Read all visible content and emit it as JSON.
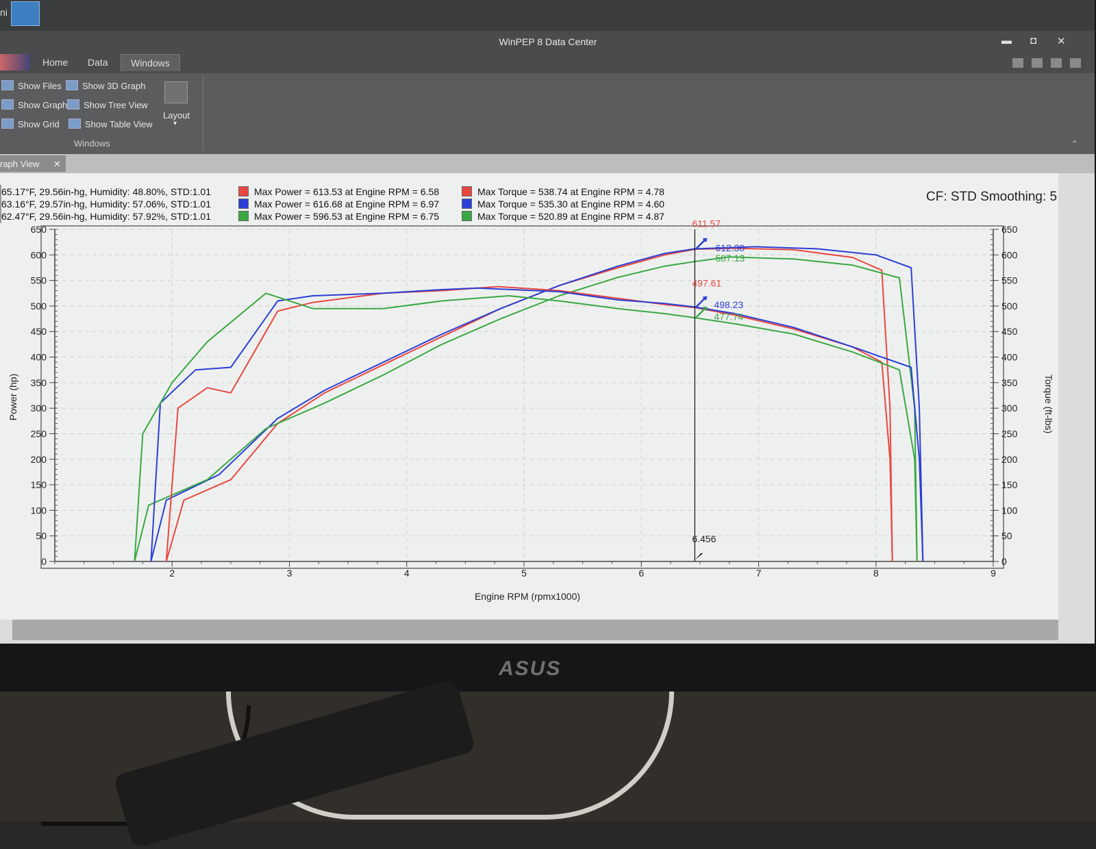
{
  "window": {
    "title": "WinPEP 8 Data Center",
    "desktop_label": "ni",
    "minimize": "▬",
    "maximize": "◘",
    "close": "✕"
  },
  "tabs": {
    "home": "Home",
    "data": "Data",
    "windows": "Windows"
  },
  "ribbon": {
    "show_files": "Show Files",
    "show_graph": "Show Graph",
    "show_grid": "Show Grid",
    "show_3d_graph": "Show 3D Graph",
    "show_tree_view": "Show Tree View",
    "show_table_view": "Show Table View",
    "layout": "Layout",
    "layout_arrow": "▾",
    "group_label": "Windows",
    "collapse": "⌃"
  },
  "doc_tab": {
    "label": "raph View",
    "close": "✕"
  },
  "graph": {
    "cf_text": "CF: STD Smoothing: 5",
    "legend": [
      {
        "conditions": "65.17°F, 29.56in-hg, Humidity: 48.80%, STD:1.01",
        "max_power": "Max Power = 613.53 at Engine RPM = 6.58",
        "max_torque": "Max Torque = 538.74 at Engine RPM = 4.78",
        "color": "#e8473f"
      },
      {
        "conditions": "63.16°F, 29.57in-hg, Humidity: 57.06%, STD:1.01",
        "max_power": "Max Power = 616.68 at Engine RPM = 6.97",
        "max_torque": "Max Torque = 535.30 at Engine RPM = 4.60",
        "color": "#2b3fd6"
      },
      {
        "conditions": "62.47°F, 29.56in-hg, Humidity: 57.92%, STD:1.01",
        "max_power": "Max Power = 596.53 at Engine RPM = 6.75",
        "max_torque": "Max Torque = 520.89 at Engine RPM = 4.87",
        "color": "#3aa843"
      }
    ],
    "cursor": {
      "rpm_label": "6.456",
      "rpm": 6.456
    },
    "cursor_values": {
      "power_red": "611.57",
      "power_blue": "612.30",
      "power_green": "587.13",
      "torque_red": "497.61",
      "torque_blue": "498.23",
      "torque_green": "477.74"
    }
  },
  "chart_data": {
    "type": "line",
    "xlabel": "Engine RPM (rpmx1000)",
    "ylabel": "Power (hp)",
    "y2label": "Torque (ft-lbs)",
    "xlim": [
      1,
      9
    ],
    "ylim": [
      0,
      650
    ],
    "x_ticks": [
      "2",
      "3",
      "4",
      "5",
      "6",
      "7",
      "8",
      "9"
    ],
    "y_ticks": [
      "0",
      "50",
      "100",
      "150",
      "200",
      "250",
      "300",
      "350",
      "400",
      "450",
      "500",
      "550",
      "600",
      "650"
    ],
    "y2_ticks": [
      "0",
      "50",
      "100",
      "150",
      "200",
      "250",
      "300",
      "350",
      "400",
      "450",
      "500",
      "550",
      "600",
      "650"
    ],
    "grid": true,
    "series": [
      {
        "kind": "power",
        "color": "#e8473f",
        "x": [
          1.95,
          2.1,
          2.5,
          2.9,
          3.3,
          3.8,
          4.3,
          4.8,
          5.3,
          5.8,
          6.2,
          6.456,
          6.8,
          7.3,
          7.8,
          8.05,
          8.12,
          8.14
        ],
        "y": [
          0,
          120,
          160,
          270,
          330,
          385,
          440,
          495,
          540,
          575,
          600,
          611,
          613,
          610,
          595,
          570,
          300,
          0
        ]
      },
      {
        "kind": "power",
        "color": "#2b3fd6",
        "x": [
          1.82,
          1.95,
          2.4,
          2.9,
          3.3,
          3.8,
          4.3,
          4.8,
          5.3,
          5.8,
          6.2,
          6.456,
          6.97,
          7.5,
          8.0,
          8.3,
          8.37,
          8.4
        ],
        "y": [
          0,
          120,
          170,
          280,
          335,
          390,
          445,
          495,
          540,
          578,
          603,
          612,
          616,
          612,
          600,
          575,
          300,
          0
        ]
      },
      {
        "kind": "power",
        "color": "#3aa843",
        "x": [
          1.68,
          1.8,
          2.3,
          2.8,
          3.3,
          3.8,
          4.3,
          4.8,
          5.3,
          5.8,
          6.2,
          6.456,
          6.75,
          7.3,
          7.8,
          8.2,
          8.33,
          8.35
        ],
        "y": [
          0,
          110,
          160,
          260,
          310,
          365,
          425,
          475,
          520,
          556,
          578,
          587,
          596,
          592,
          580,
          555,
          300,
          0
        ]
      },
      {
        "kind": "torque",
        "color": "#e8473f",
        "x": [
          1.95,
          2.05,
          2.3,
          2.5,
          2.9,
          3.2,
          3.8,
          4.3,
          4.78,
          5.3,
          5.8,
          6.2,
          6.456,
          6.8,
          7.3,
          7.8,
          8.05,
          8.12,
          8.14
        ],
        "y": [
          0,
          300,
          340,
          330,
          490,
          507,
          525,
          530,
          538,
          530,
          515,
          503,
          497,
          482,
          455,
          420,
          390,
          200,
          0
        ]
      },
      {
        "kind": "torque",
        "color": "#2b3fd6",
        "x": [
          1.82,
          1.9,
          2.2,
          2.5,
          2.9,
          3.2,
          3.8,
          4.3,
          4.6,
          5.3,
          5.8,
          6.2,
          6.456,
          6.8,
          7.3,
          7.8,
          8.3,
          8.37,
          8.4
        ],
        "y": [
          0,
          310,
          375,
          380,
          510,
          520,
          525,
          532,
          535,
          528,
          512,
          505,
          498,
          485,
          458,
          420,
          380,
          200,
          0
        ]
      },
      {
        "kind": "torque",
        "color": "#3aa843",
        "x": [
          1.68,
          1.75,
          2.0,
          2.3,
          2.8,
          3.2,
          3.8,
          4.3,
          4.87,
          5.3,
          5.8,
          6.2,
          6.456,
          6.8,
          7.3,
          7.8,
          8.2,
          8.33,
          8.35
        ],
        "y": [
          0,
          250,
          350,
          430,
          525,
          495,
          495,
          510,
          520,
          510,
          495,
          485,
          477,
          465,
          445,
          410,
          375,
          200,
          0
        ]
      }
    ]
  }
}
